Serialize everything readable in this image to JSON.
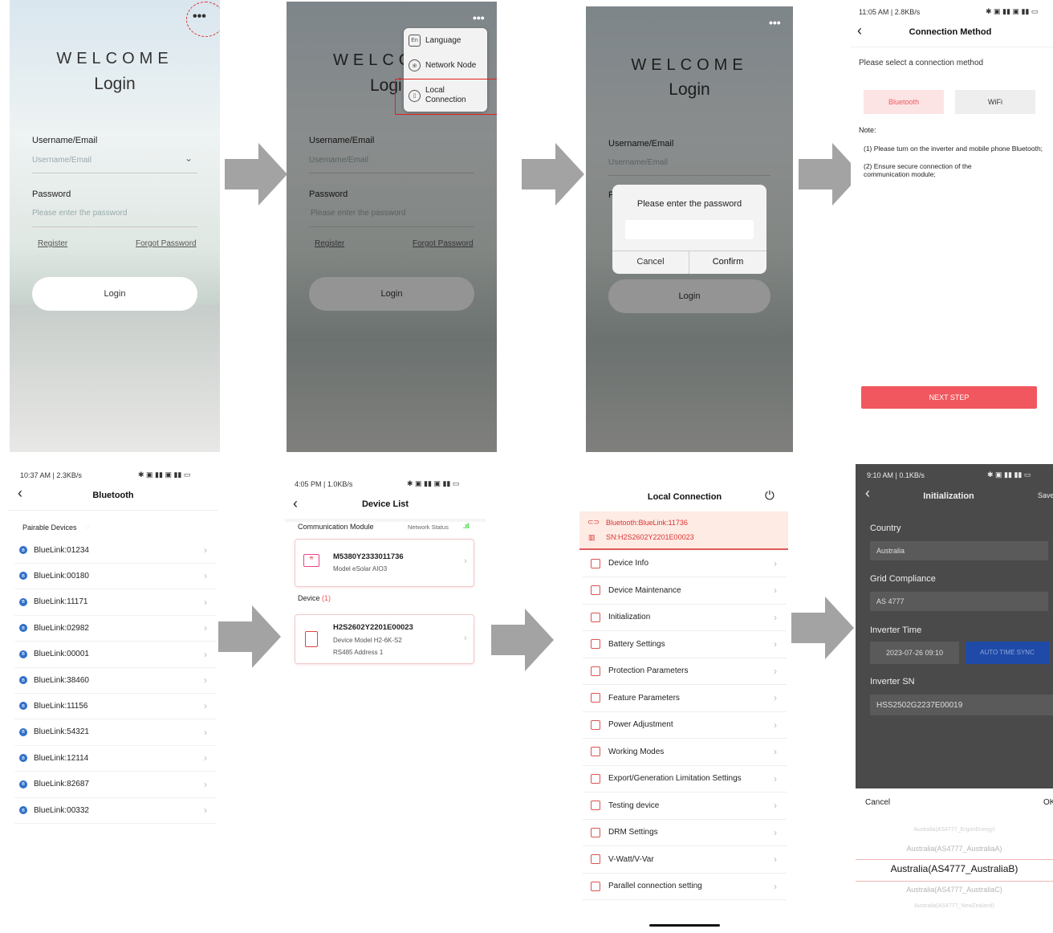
{
  "screen1": {
    "more_icon": "more-dots-icon",
    "welcome": "WELCOME",
    "title": "Login",
    "username_label": "Username/Email",
    "username_placeholder": "Username/Email",
    "password_label": "Password",
    "password_placeholder": "Please enter the password",
    "register": "Register",
    "forgot": "Forgot Password",
    "login_button": "Login"
  },
  "screen2": {
    "welcome": "WELCO",
    "title": "Logi",
    "username_label": "Username/Email",
    "username_placeholder": "Username/Email",
    "password_label": "Password",
    "password_placeholder": "Please enter the password",
    "register": "Register",
    "forgot": "Forgot Password",
    "login_button": "Login",
    "menu": [
      {
        "label": "Language",
        "icon": "language-icon"
      },
      {
        "label": "Network Node",
        "icon": "globe-icon"
      },
      {
        "label": "Local\nConnection",
        "icon": "local-connection-icon"
      }
    ]
  },
  "screen3": {
    "welcome": "WELCOME",
    "title": "Login",
    "username_label": "Username/Email",
    "username_placeholder": "Username/Email",
    "password_label": "P",
    "login_button": "Login",
    "dialog": {
      "title": "Please enter the password",
      "cancel": "Cancel",
      "confirm": "Confirm"
    }
  },
  "screen4": {
    "status_time": "11:05 AM | 2.8KB/s",
    "title": "Connection Method",
    "prompt": "Please select a connection method",
    "option_bluetooth": "Bluetooth",
    "option_wifi": "WiFi",
    "note_label": "Note:",
    "note_1": "(1) Please turn on the inverter and mobile phone Bluetooth;",
    "note_2": "(2) Ensure secure connection of the communication module;",
    "next_button": "NEXT STEP"
  },
  "screen5": {
    "status_time": "10:37 AM | 2.3KB/s",
    "title": "Bluetooth",
    "section": "Pairable Devices",
    "devices": [
      "BlueLink:01234",
      "BlueLink:00180",
      "BlueLink:11171",
      "BlueLink:02982",
      "BlueLink:00001",
      "BlueLink:38460",
      "BlueLink:11156",
      "BlueLink:54321",
      "BlueLink:12114",
      "BlueLink:82687",
      "BlueLink:00332"
    ]
  },
  "screen6": {
    "status_time": "4:05 PM | 1.0KB/s",
    "title": "Device List",
    "module_section": "Communication Module",
    "network_status": "Network Status",
    "module_sn": "M5380Y2333011736",
    "module_model": "Model  eSolar AIO3",
    "device_section": "Device",
    "device_count": "(1)",
    "device_sn": "H2S2602Y2201E00023",
    "device_model": "Device Model  H2-6K-S2",
    "device_address": "RS485 Address  1"
  },
  "screen7": {
    "title": "Local Connection",
    "bluetooth_line": "Bluetooth:BlueLink:11736",
    "sn_line": "SN:H2S2602Y2201E00023",
    "menu": [
      "Device Info",
      "Device Maintenance",
      "Initialization",
      "Battery Settings",
      "Protection Parameters",
      "Feature Parameters",
      "Power Adjustment",
      "Working Modes",
      "Export/Generation Limitation Settings",
      "Testing device",
      "DRM Settings",
      "V-Watt/V-Var",
      "Parallel connection setting"
    ]
  },
  "screen8": {
    "status_time": "9:10 AM | 0.1KB/s",
    "title": "Initialization",
    "save": "Save",
    "country_label": "Country",
    "country_value": "Australia",
    "grid_label": "Grid Compliance",
    "grid_value": "AS 4777",
    "time_label": "Inverter Time",
    "time_value": "2023-07-26 09:10",
    "sync_button": "AUTO TIME SYNC",
    "sn_label": "Inverter SN",
    "sn_value": "HSS2502G2237E00019",
    "cancel": "Cancel",
    "ok": "OK",
    "picker": [
      "Australia(AS4777_ErgonEnergy)",
      "Australia(AS4777_AustraliaA)",
      "Australia(AS4777_AustraliaB)",
      "Australia(AS4777_AustraliaC)",
      "Australia(AS4777_NewZealand)"
    ]
  },
  "colors": {
    "accent_red": "#f0575f",
    "blue_sync": "#1f4aa8",
    "bt_blue": "#2f6fc9"
  }
}
